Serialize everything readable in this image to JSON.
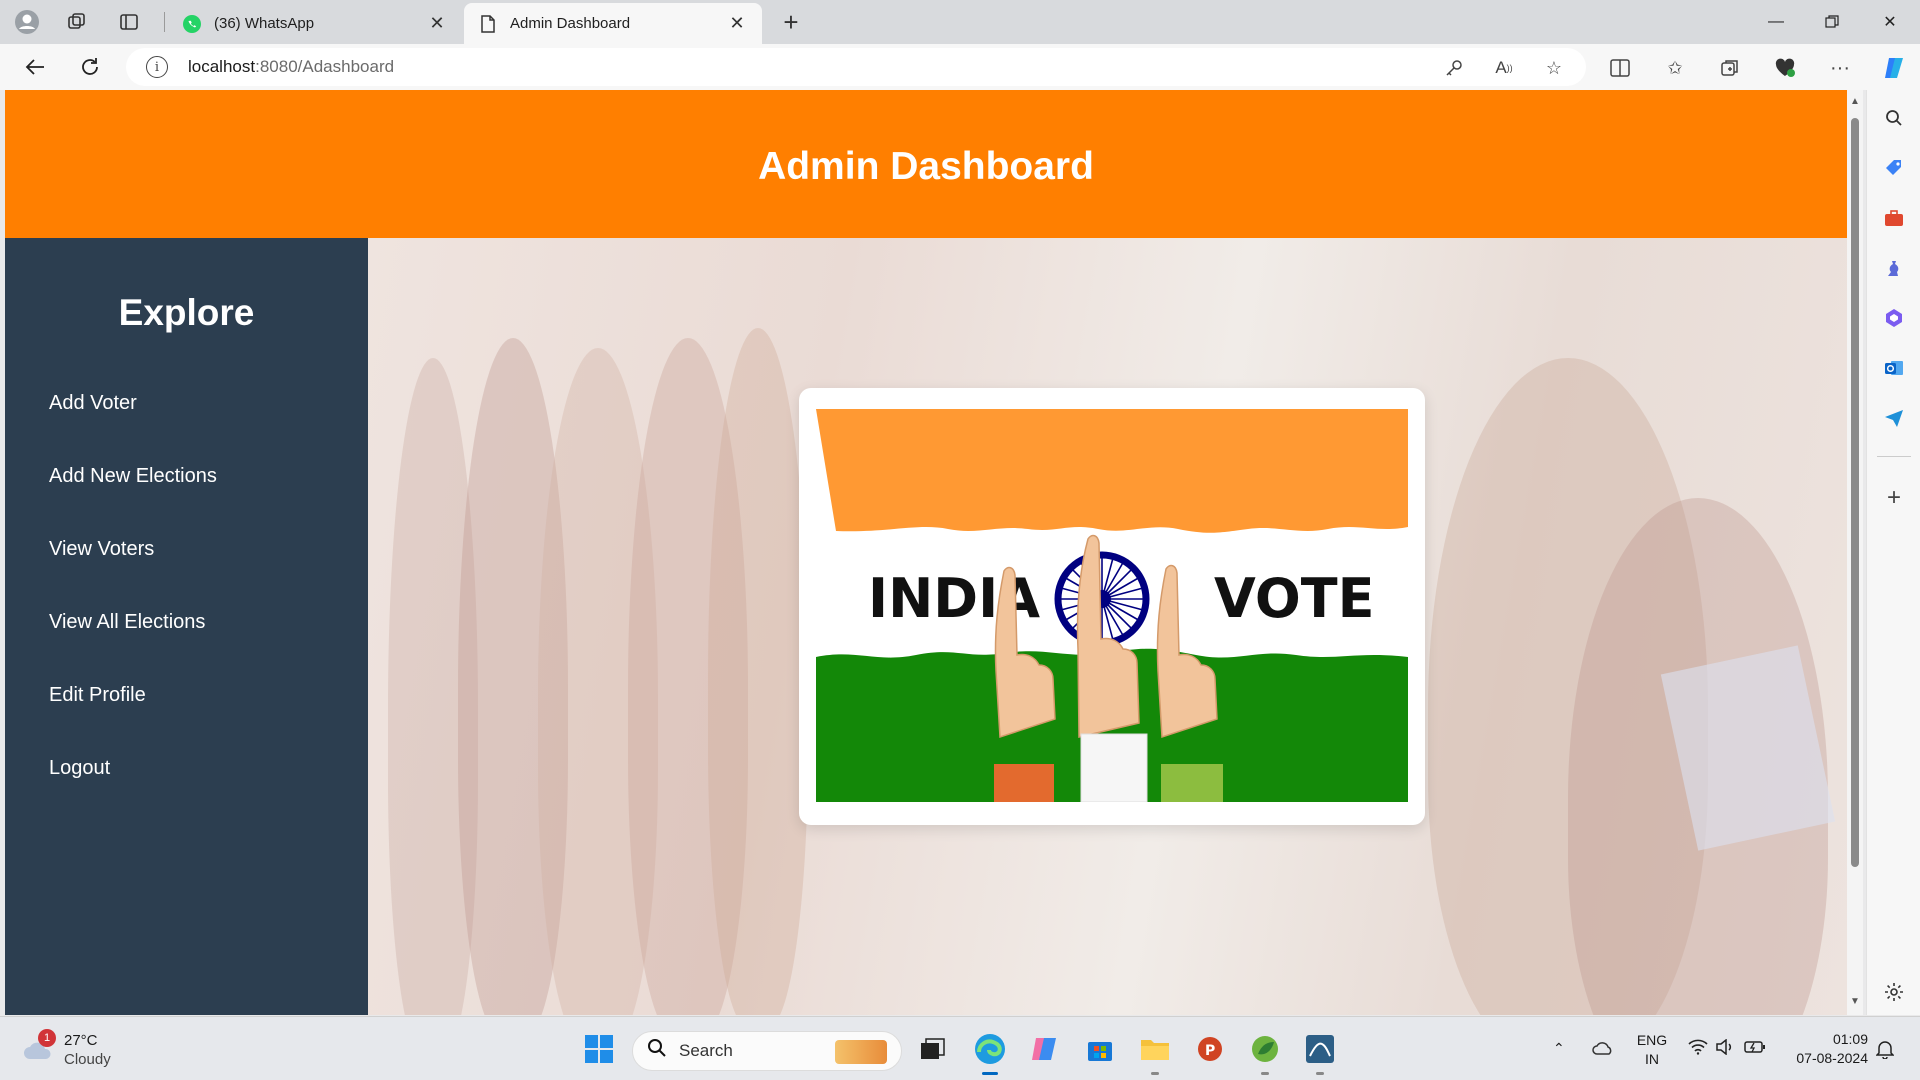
{
  "browser": {
    "tabs": [
      {
        "label": "(36) WhatsApp",
        "icon": "whatsapp-icon",
        "active": false
      },
      {
        "label": "Admin Dashboard",
        "icon": "page-icon",
        "active": true
      }
    ],
    "url_host": "localhost",
    "url_path": ":8080/Adashboard"
  },
  "page": {
    "header_title": "Admin Dashboard",
    "sidebar_title": "Explore",
    "nav_items": [
      "Add Voter",
      "Add New Elections",
      "View Voters",
      "View All Elections",
      "Edit Profile",
      "Logout"
    ],
    "card_image": {
      "left_word": "INDIA",
      "right_word": "VOTE",
      "colors": {
        "saffron": "#ff9933",
        "white": "#ffffff",
        "green": "#138808",
        "chakra": "#000080"
      }
    }
  },
  "colors": {
    "header_bg": "#ff7f00",
    "sidebar_bg": "#2c3e50"
  },
  "taskbar": {
    "weather_temp": "27°C",
    "weather_desc": "Cloudy",
    "weather_badge": "1",
    "search_placeholder": "Search",
    "lang_line1": "ENG",
    "lang_line2": "IN",
    "time": "01:09",
    "date": "07-08-2024"
  }
}
